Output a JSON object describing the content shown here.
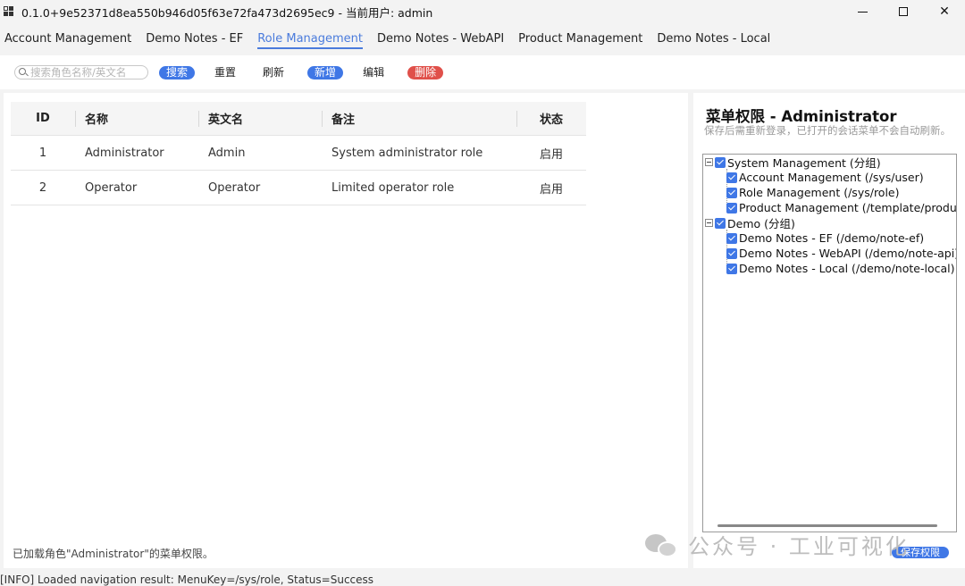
{
  "window": {
    "title": "0.1.0+9e52371d8ea550b946d05f63e72fa473d2695ec9 - 当前用户: admin"
  },
  "nav_tabs": [
    {
      "label": "Account Management"
    },
    {
      "label": "Demo Notes - EF"
    },
    {
      "label": "Role Management",
      "active": true
    },
    {
      "label": "Demo Notes - WebAPI"
    },
    {
      "label": "Product Management"
    },
    {
      "label": "Demo Notes - Local"
    }
  ],
  "toolbar": {
    "search_placeholder": "搜索角色名称/英文名",
    "search_value": "",
    "search_label": "搜索",
    "reset_label": "重置",
    "refresh_label": "刷新",
    "add_label": "新增",
    "edit_label": "编辑",
    "delete_label": "删除"
  },
  "table": {
    "columns": [
      "ID",
      "名称",
      "英文名",
      "备注",
      "状态"
    ],
    "rows": [
      {
        "id": "1",
        "name": "Administrator",
        "en_name": "Admin",
        "note": "System administrator role",
        "status": "启用"
      },
      {
        "id": "2",
        "name": "Operator",
        "en_name": "Operator",
        "note": "Limited operator role",
        "status": "启用"
      }
    ]
  },
  "status_message": "已加载角色\"Administrator\"的菜单权限。",
  "permissions": {
    "title": "菜单权限 - Administrator",
    "hint": "保存后需重新登录，已打开的会话菜单不会自动刷新。",
    "tree": [
      {
        "label": "System Management (分组)",
        "checked": true,
        "children": [
          {
            "label": "Account Management (/sys/user)",
            "checked": true
          },
          {
            "label": "Role Management (/sys/role)",
            "checked": true
          },
          {
            "label": "Product Management (/template/product)",
            "checked": true
          }
        ]
      },
      {
        "label": "Demo (分组)",
        "checked": true,
        "children": [
          {
            "label": "Demo Notes - EF (/demo/note-ef)",
            "checked": true
          },
          {
            "label": "Demo Notes - WebAPI (/demo/note-api)",
            "checked": true
          },
          {
            "label": "Demo Notes - Local (/demo/note-local)",
            "checked": true
          }
        ]
      }
    ],
    "save_label": "保存权限"
  },
  "watermark_text": "公众号 · 工业可视化",
  "log_line": "[INFO] Loaded navigation result: MenuKey=/sys/role, Status=Success",
  "colors": {
    "accent": "#3f77e6",
    "danger": "#e0504a",
    "active_tab": "#4a7bdc"
  }
}
